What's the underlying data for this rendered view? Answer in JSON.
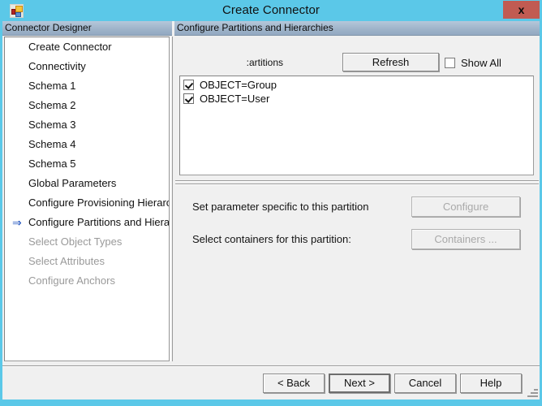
{
  "window": {
    "title": "Create Connector",
    "app_icon": "connector-app-icon",
    "close_label": "x",
    "titlebar_color": "#5BC8E8",
    "close_button_color": "#C15B52",
    "dialog_background": "#F0F0F0"
  },
  "left_panel": {
    "header": "Connector Designer",
    "items": [
      {
        "label": "Create Connector",
        "state": "enabled",
        "current": false
      },
      {
        "label": "Connectivity",
        "state": "enabled",
        "current": false
      },
      {
        "label": "Schema 1",
        "state": "enabled",
        "current": false
      },
      {
        "label": "Schema 2",
        "state": "enabled",
        "current": false
      },
      {
        "label": "Schema 3",
        "state": "enabled",
        "current": false
      },
      {
        "label": "Schema 4",
        "state": "enabled",
        "current": false
      },
      {
        "label": "Schema 5",
        "state": "enabled",
        "current": false
      },
      {
        "label": "Global Parameters",
        "state": "enabled",
        "current": false
      },
      {
        "label": "Configure Provisioning Hierarchy",
        "state": "enabled",
        "current": false
      },
      {
        "label": "Configure Partitions and Hierarchies",
        "state": "enabled",
        "current": true,
        "arrow_icon": "right-arrow-icon",
        "arrow_glyph": "⇒"
      },
      {
        "label": "Select Object Types",
        "state": "disabled",
        "current": false
      },
      {
        "label": "Select Attributes",
        "state": "disabled",
        "current": false
      },
      {
        "label": "Configure Anchors",
        "state": "disabled",
        "current": false
      }
    ]
  },
  "right_panel": {
    "header": "Configure Partitions and Hierarchies",
    "partitions_label": "artitions:",
    "refresh_label": "Refresh",
    "show_all": {
      "label": "Show All",
      "checked": false
    },
    "partitions": [
      {
        "label": "OBJECT=Group",
        "checked": true
      },
      {
        "label": "OBJECT=User",
        "checked": true
      }
    ],
    "detail": {
      "configure_text": "Set parameter specific to this partition",
      "configure_button": "Configure",
      "configure_enabled": false,
      "containers_text": "Select containers for this partition:",
      "containers_button": "Containers ...",
      "containers_enabled": false
    }
  },
  "footer": {
    "back": "< Back",
    "next": "Next >",
    "cancel": "Cancel",
    "help": "Help"
  }
}
